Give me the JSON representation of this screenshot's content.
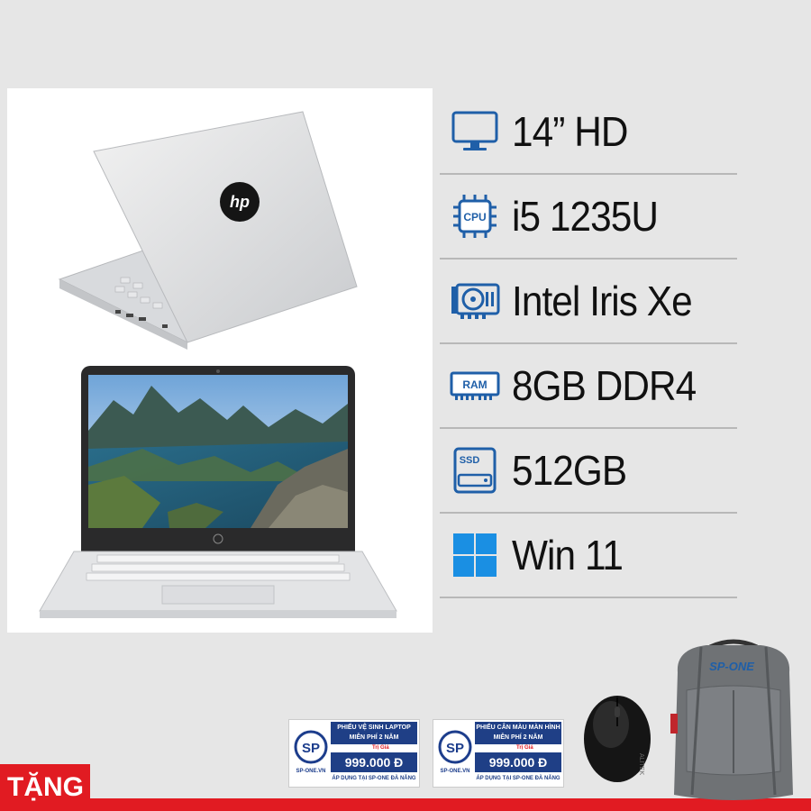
{
  "specs": [
    {
      "icon": "monitor-icon",
      "text": "14” HD"
    },
    {
      "icon": "cpu-icon",
      "text": "i5 1235U",
      "badge": "CPU"
    },
    {
      "icon": "gpu-icon",
      "text": "Intel Iris Xe"
    },
    {
      "icon": "ram-icon",
      "text": "8GB DDR4",
      "badge": "RAM"
    },
    {
      "icon": "ssd-icon",
      "text": "512GB",
      "badge": "SSD"
    },
    {
      "icon": "windows-icon",
      "text": "Win 11"
    }
  ],
  "gift": {
    "label": "TẶNG",
    "vouchers": [
      {
        "title": "PHIẾU VỆ SINH LAPTOP MIỄN PHÍ 2 NĂM",
        "value_label": "Trị Giá",
        "price": "999.000 Đ",
        "footer": "ÁP DỤNG TẠI SP-ONE ĐÀ NẴNG",
        "brand": "SP-ONE.VN"
      },
      {
        "title": "PHIẾU CÂN MÀU MÀN HÌNH MIỄN PHÍ 2 NĂM",
        "value_label": "Trị Giá",
        "price": "999.000 Đ",
        "footer": "ÁP DỤNG TẠI SP-ONE ĐÀ NẴNG",
        "brand": "SP-ONE.VN"
      }
    ],
    "mouse_brand": "ALITEK",
    "backpack_brand": "SP-ONE"
  },
  "colors": {
    "accent_red": "#e11b22",
    "icon_blue": "#1f5fa8",
    "voucher_blue": "#1f3f86"
  }
}
